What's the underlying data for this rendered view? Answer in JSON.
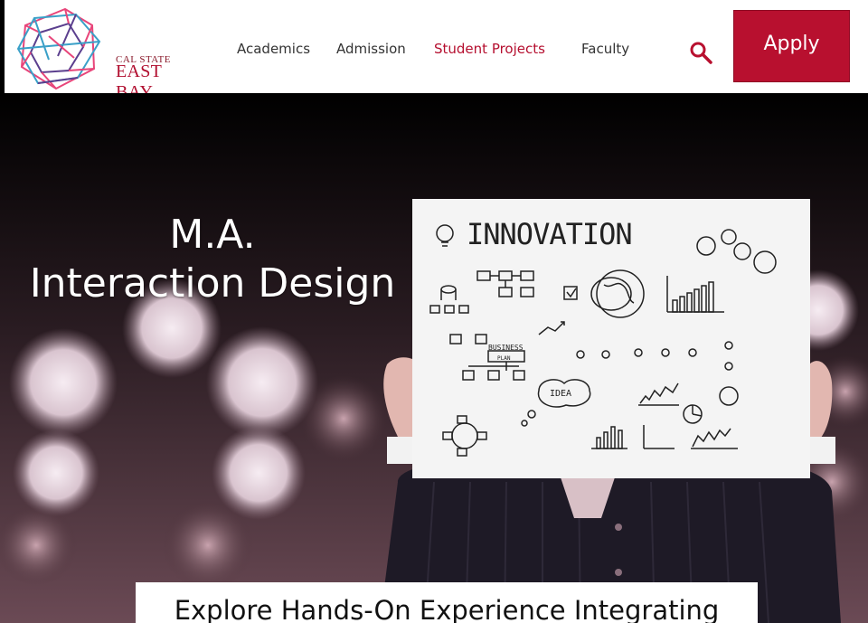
{
  "header": {
    "logo": {
      "line1": "CAL STATE",
      "line2": "EAST BAY",
      "icon": "wireframe-cube-logo"
    },
    "nav": [
      {
        "label": "Academics",
        "active": false
      },
      {
        "label": "Admission",
        "active": false
      },
      {
        "label": "Student Projects",
        "active": true
      },
      {
        "label": "Faculty",
        "active": false
      }
    ],
    "search_icon": "search-icon",
    "apply_label": "Apply"
  },
  "hero": {
    "title_line1": "M.A.",
    "title_line2": "Interaction Design",
    "board_title": "INNOVATION",
    "board_labels": {
      "business": "BUSINESS",
      "plan": "PLAN",
      "idea": "IDEA"
    }
  },
  "callout": {
    "text": "Explore Hands-On Experience Integrating"
  },
  "colors": {
    "brand_red": "#b8102f",
    "active_nav": "#b50f2f",
    "text": "#333333"
  }
}
